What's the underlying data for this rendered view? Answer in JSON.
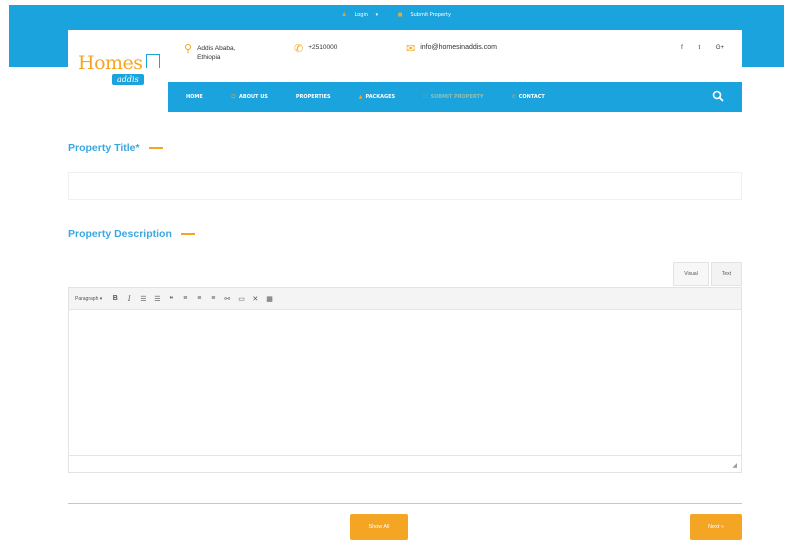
{
  "topbar": {
    "login_label": "Login",
    "submit_label": "Submit Property"
  },
  "header": {
    "logo_main": "Homes",
    "logo_sub": "addis",
    "address_line1": "Addis Ababa,",
    "address_line2": "Ethiopia",
    "phone": "+2510000",
    "email": "info@homesinaddis.com",
    "social": [
      "f",
      "t",
      "G+"
    ]
  },
  "nav": {
    "items": [
      {
        "label": "HOME",
        "icon": ""
      },
      {
        "label": "ABOUT US",
        "icon": "☺"
      },
      {
        "label": "PROPERTIES",
        "icon": ""
      },
      {
        "label": "PACKAGES",
        "icon": "▲"
      },
      {
        "label": "SUBMIT PROPERTY",
        "icon": "☐"
      },
      {
        "label": "CONTACT",
        "icon": "✆"
      }
    ]
  },
  "form": {
    "title_label": "Property Title*",
    "title_value": "",
    "description_label": "Property Description",
    "tab_visual": "Visual",
    "tab_text": "Text",
    "format_select": "Paragraph",
    "show_all_button": "Show All",
    "next_button": "Next »"
  },
  "colors": {
    "brand_blue": "#1ba3dd",
    "accent_orange": "#f5a524"
  }
}
